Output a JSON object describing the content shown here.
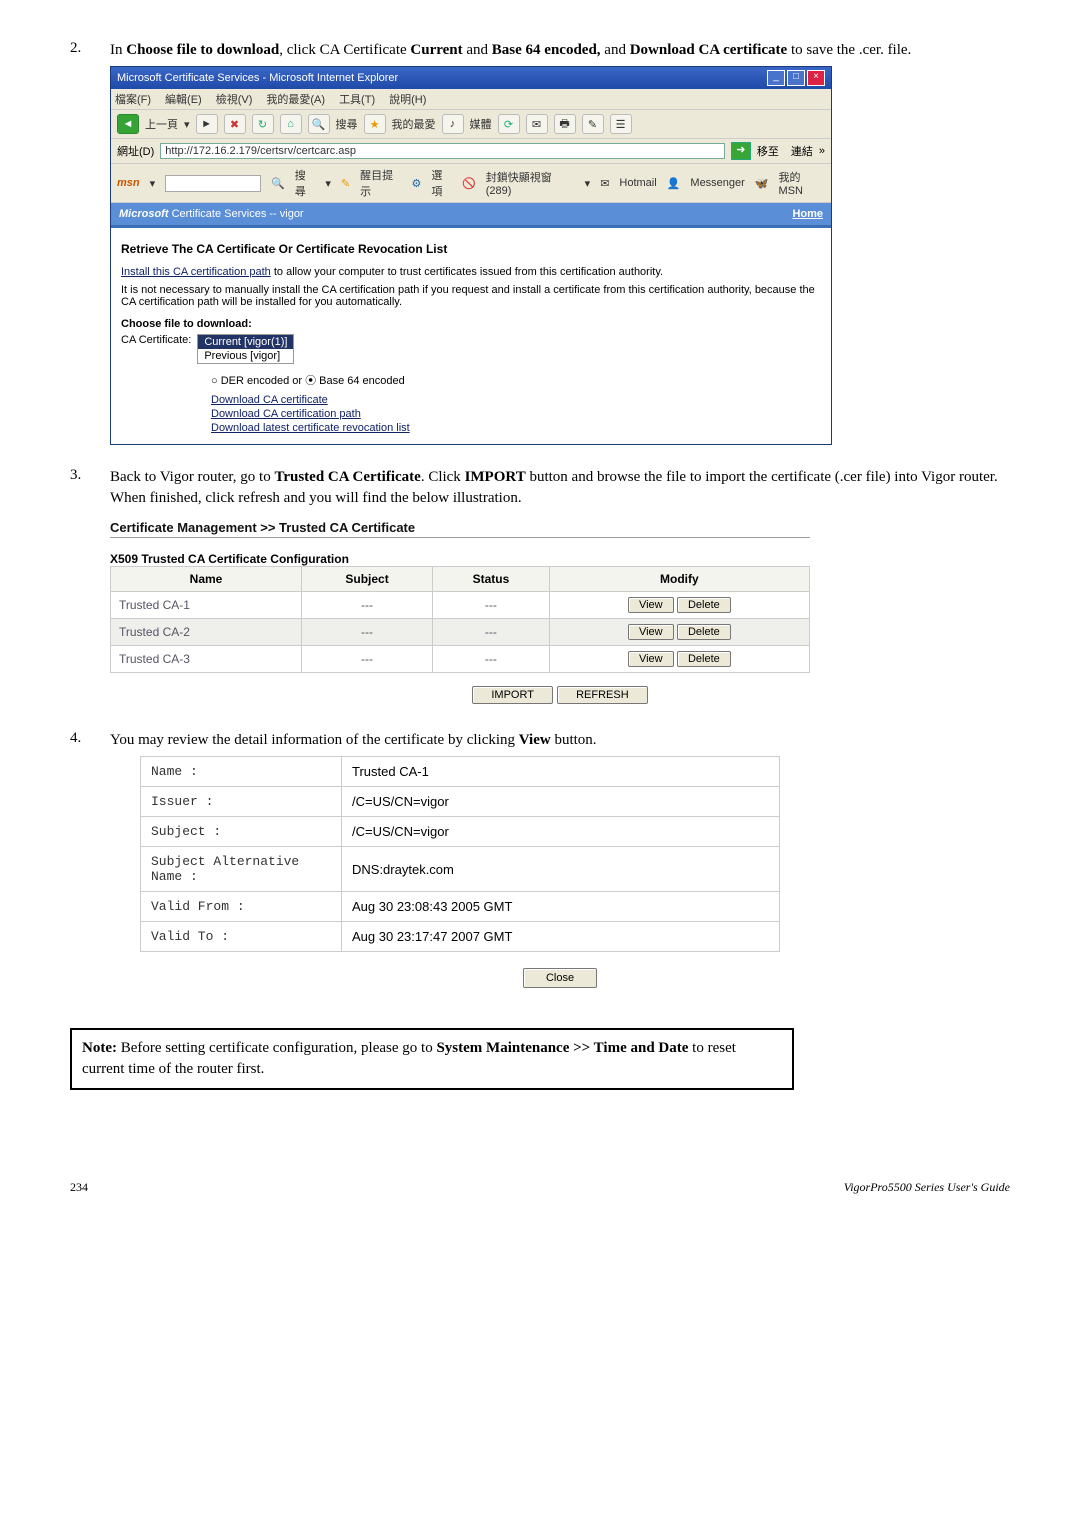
{
  "steps": {
    "s2": {
      "num": "2.",
      "pre": "In ",
      "bold1": "Choose file to download",
      "mid1": ", click CA Certificate ",
      "bold2": "Current",
      "mid2": " and ",
      "bold3": "Base 64 encoded,",
      "mid3": " and ",
      "bold4": "Download CA certificate",
      "tail": " to save the .cer. file."
    },
    "s3": {
      "num": "3.",
      "text1": "Back to Vigor router, go to ",
      "bold1": "Trusted CA Certificate",
      "text2": ". Click ",
      "bold2": "IMPORT",
      "text3": " button and browse the file to import the certificate (.cer file) into Vigor router. When finished, click refresh and you will find the below illustration."
    },
    "s4": {
      "num": "4.",
      "text1": "You may review the detail information of the certificate by clicking ",
      "bold1": "View",
      "text2": " button."
    }
  },
  "ie": {
    "title": "Microsoft Certificate Services - Microsoft Internet Explorer",
    "menu": [
      "檔案(F)",
      "編輯(E)",
      "檢視(V)",
      "我的最愛(A)",
      "工具(T)",
      "說明(H)"
    ],
    "toolbar": {
      "back": "上一頁",
      "search": "搜尋",
      "fav": "我的最愛",
      "msgr": "媒體"
    },
    "addr_label": "網址(D)",
    "addr": "http://172.16.2.179/certsrv/certcarc.asp",
    "go": "移至",
    "links": "連結",
    "msn": {
      "logo": "msn",
      "search": "搜尋",
      "highlight": "醒目提示",
      "opts": "選項",
      "blocker": "封鎖快顯視窗 (289)",
      "hotmail": "Hotmail",
      "messenger": "Messenger",
      "mymsn": "我的 MSN"
    },
    "bluebar_left_b": "Microsoft",
    "bluebar_left": " Certificate Services  --  vigor",
    "home": "Home",
    "section": "Retrieve The CA Certificate Or Certificate Revocation List",
    "p1_link": "Install this CA certification path",
    "p1_rest": " to allow your computer to trust certificates issued from this certification authority.",
    "p2": "It is not necessary to manually install the CA certification path if you request and install a certificate from this certification authority, because the CA certification path will be installed for you automatically.",
    "choose_h": "Choose file to download:",
    "cacert_label": "CA Certificate:",
    "cur": "Current [vigor(1)]",
    "prev": "Previous [vigor]",
    "radio": "○ DER encoded   or   ⦿ Base 64 encoded",
    "dl1": "Download CA certificate",
    "dl2": "Download CA certification path",
    "dl3": "Download latest certificate revocation list"
  },
  "cm": {
    "title": "Certificate Management >> Trusted CA Certificate",
    "x509": "X509 Trusted CA Certificate Configuration",
    "headers": {
      "name": "Name",
      "subject": "Subject",
      "status": "Status",
      "modify": "Modify"
    },
    "rows": [
      {
        "name": "Trusted CA-1",
        "subject": "---",
        "status": "---"
      },
      {
        "name": "Trusted CA-2",
        "subject": "---",
        "status": "---"
      },
      {
        "name": "Trusted CA-3",
        "subject": "---",
        "status": "---"
      }
    ],
    "view": "View",
    "delete": "Delete",
    "import": "IMPORT",
    "refresh": "REFRESH"
  },
  "detail": {
    "rows": [
      {
        "k": "Name :",
        "v": "Trusted CA-1"
      },
      {
        "k": "Issuer :",
        "v": "/C=US/CN=vigor"
      },
      {
        "k": "Subject :",
        "v": "/C=US/CN=vigor"
      },
      {
        "k": "Subject Alternative Name :",
        "v": "DNS:draytek.com"
      },
      {
        "k": "Valid From :",
        "v": "Aug 30 23:08:43 2005 GMT"
      },
      {
        "k": "Valid To :",
        "v": "Aug 30 23:17:47 2007 GMT"
      }
    ],
    "close": "Close"
  },
  "note": {
    "head": "Note:",
    "t1": " Before setting certificate configuration, please go to ",
    "b1": "System Maintenance >> Time and Date",
    "t2": " to reset current time of the router first."
  },
  "footer": {
    "page": "234",
    "guide": "VigorPro5500  Series  User's Guide"
  }
}
